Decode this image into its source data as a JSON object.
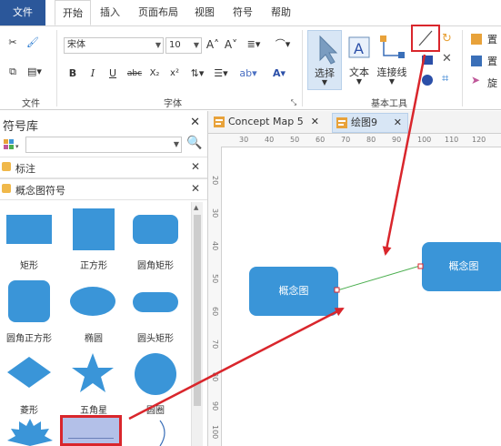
{
  "menu": {
    "file": "文件",
    "items": [
      "开始",
      "插入",
      "页面布局",
      "视图",
      "符号",
      "帮助"
    ]
  },
  "ribbon": {
    "font_name": "宋体",
    "font_size": "10",
    "groups": {
      "file": "文件",
      "font": "字体",
      "basic_tools": "基本工具"
    },
    "format_buttons": [
      "B",
      "I",
      "U",
      "abc",
      "X₂",
      "x²"
    ],
    "tools": {
      "select": "选择",
      "text": "文本",
      "connector": "连接线"
    },
    "right_items": [
      "置",
      "置",
      "旋"
    ]
  },
  "library": {
    "title": "符号库",
    "categories": [
      "标注",
      "概念图符号"
    ],
    "shapes": [
      {
        "label": "矩形"
      },
      {
        "label": "正方形"
      },
      {
        "label": "圆角矩形"
      },
      {
        "label": "圆角正方形"
      },
      {
        "label": "椭圆"
      },
      {
        "label": "圆头矩形"
      },
      {
        "label": "菱形"
      },
      {
        "label": "五角星"
      },
      {
        "label": "圆圈"
      }
    ]
  },
  "tabs": [
    {
      "label": "Concept Map 5",
      "close": "✕"
    },
    {
      "label": "绘图9",
      "close": "✕"
    }
  ],
  "ruler": {
    "h": [
      "30",
      "40",
      "50",
      "60",
      "70",
      "80",
      "90",
      "100",
      "110",
      "120"
    ],
    "v": [
      "20",
      "30",
      "40",
      "50",
      "60",
      "70",
      "80",
      "90",
      "100"
    ]
  },
  "canvas": {
    "node_left": "概念图",
    "node_right": "概念图"
  },
  "colors": {
    "accent": "#2b579a",
    "shape_blue": "#3a95d8",
    "highlight_red": "#d9262c",
    "connector_green": "#4caf50"
  }
}
